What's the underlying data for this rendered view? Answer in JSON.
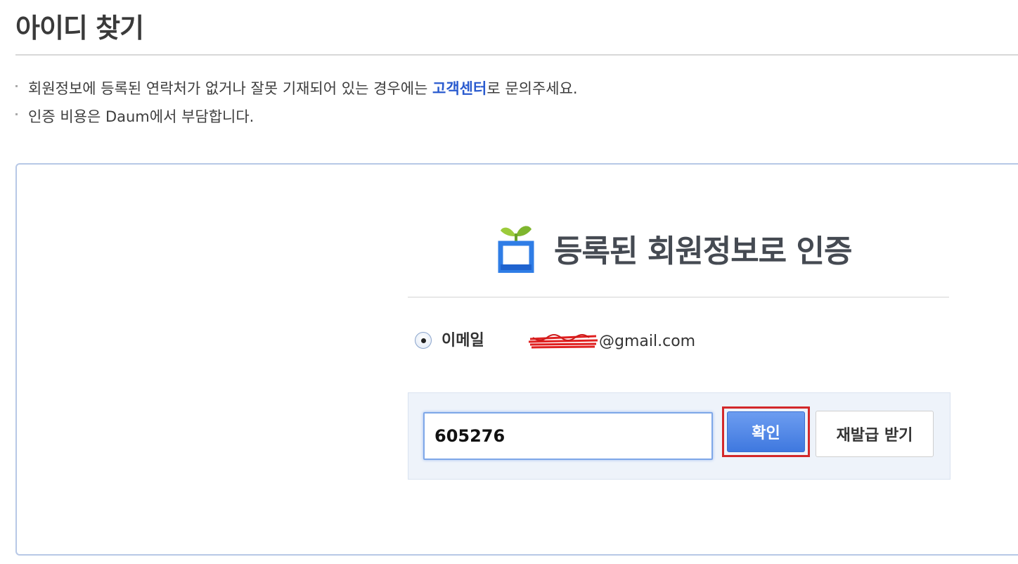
{
  "page": {
    "title": "아이디 찾기"
  },
  "notices": {
    "line1_before": "회원정보에 등록된 연락처가 없거나 잘못 기재되어 있는 경우에는 ",
    "line1_link": "고객센터",
    "line1_after": "로 문의주세요.",
    "line2": "인증 비용은 Daum에서 부담합니다."
  },
  "auth": {
    "title": "등록된 회원정보로 인증",
    "method_label": "이메일",
    "email_domain": "@gmail.com",
    "code_value": "605276",
    "confirm_label": "확인",
    "reissue_label": "재발급 받기"
  },
  "icons": {
    "sprout": "sprout-icon",
    "radio": "radio-selected-icon"
  },
  "colors": {
    "link": "#2a5bcf",
    "primary_button": "#4a82e4",
    "highlight_outline": "#d3282a",
    "panel_bg": "#eef3fa",
    "redaction": "#e02020"
  }
}
